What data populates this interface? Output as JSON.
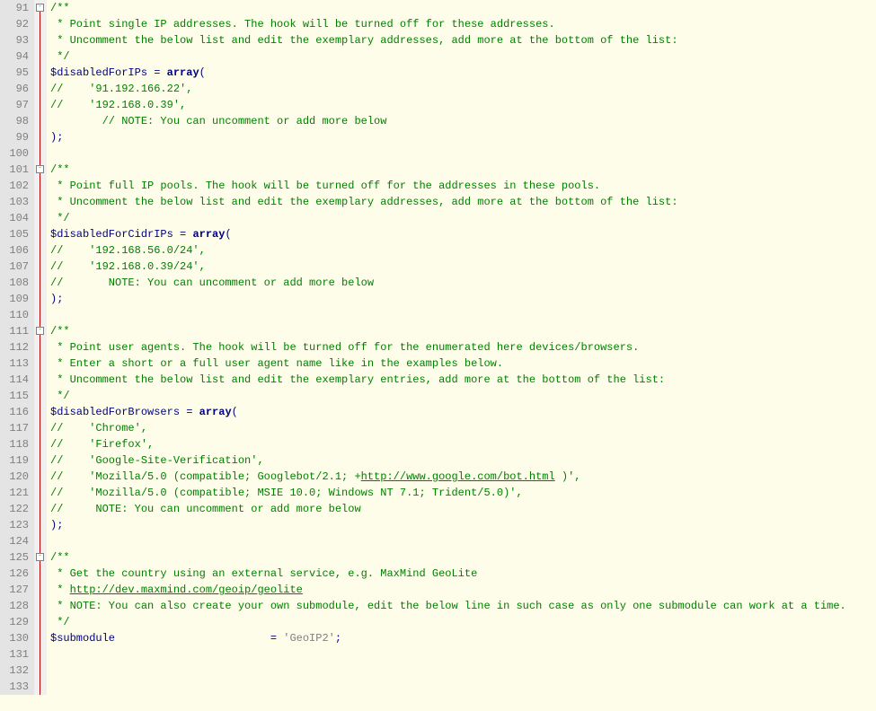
{
  "first_line": 91,
  "lines": [
    {
      "fold": "open",
      "tokens": [
        [
          "comment",
          "/**"
        ]
      ]
    },
    {
      "tokens": [
        [
          "comment",
          " * Point single IP addresses. The hook will be turned off for these addresses."
        ]
      ]
    },
    {
      "tokens": [
        [
          "comment",
          " * Uncomment the below list and edit the exemplary addresses, add more at the bottom of the list:"
        ]
      ]
    },
    {
      "tokens": [
        [
          "comment",
          " */"
        ]
      ]
    },
    {
      "tokens": [
        [
          "var",
          "$disabledForIPs"
        ],
        [
          "op",
          " "
        ],
        [
          "punct",
          "="
        ],
        [
          "op",
          " "
        ],
        [
          "keyword",
          "array"
        ],
        [
          "punct",
          "("
        ]
      ]
    },
    {
      "tokens": [
        [
          "comment",
          "//    '91.192.166.22',"
        ]
      ]
    },
    {
      "tokens": [
        [
          "comment",
          "//    '192.168.0.39',"
        ]
      ]
    },
    {
      "tokens": [
        [
          "comment",
          "        // NOTE: You can uncomment or add more below"
        ]
      ]
    },
    {
      "tokens": [
        [
          "punct",
          ");"
        ]
      ]
    },
    {
      "tokens": []
    },
    {
      "fold": "open",
      "tokens": [
        [
          "comment",
          "/**"
        ]
      ]
    },
    {
      "tokens": [
        [
          "comment",
          " * Point full IP pools. The hook will be turned off for the addresses in these pools."
        ]
      ]
    },
    {
      "tokens": [
        [
          "comment",
          " * Uncomment the below list and edit the exemplary addresses, add more at the bottom of the list:"
        ]
      ]
    },
    {
      "tokens": [
        [
          "comment",
          " */"
        ]
      ]
    },
    {
      "tokens": [
        [
          "var",
          "$disabledForCidrIPs"
        ],
        [
          "op",
          " "
        ],
        [
          "punct",
          "="
        ],
        [
          "op",
          " "
        ],
        [
          "keyword",
          "array"
        ],
        [
          "punct",
          "("
        ]
      ]
    },
    {
      "tokens": [
        [
          "comment",
          "//    '192.168.56.0/24',"
        ]
      ]
    },
    {
      "tokens": [
        [
          "comment",
          "//    '192.168.0.39/24',"
        ]
      ]
    },
    {
      "tokens": [
        [
          "comment",
          "//       NOTE: You can uncomment or add more below"
        ]
      ]
    },
    {
      "tokens": [
        [
          "punct",
          ");"
        ]
      ]
    },
    {
      "tokens": []
    },
    {
      "fold": "open",
      "tokens": [
        [
          "comment",
          "/**"
        ]
      ]
    },
    {
      "tokens": [
        [
          "comment",
          " * Point user agents. The hook will be turned off for the enumerated here devices/browsers."
        ]
      ]
    },
    {
      "tokens": [
        [
          "comment",
          " * Enter a short or a full user agent name like in the examples below."
        ]
      ]
    },
    {
      "tokens": [
        [
          "comment",
          " * Uncomment the below list and edit the exemplary entries, add more at the bottom of the list:"
        ]
      ]
    },
    {
      "tokens": [
        [
          "comment",
          " */"
        ]
      ]
    },
    {
      "tokens": [
        [
          "var",
          "$disabledForBrowsers"
        ],
        [
          "op",
          " "
        ],
        [
          "punct",
          "="
        ],
        [
          "op",
          " "
        ],
        [
          "keyword",
          "array"
        ],
        [
          "punct",
          "("
        ]
      ]
    },
    {
      "tokens": [
        [
          "comment",
          "//    'Chrome',"
        ]
      ]
    },
    {
      "tokens": [
        [
          "comment",
          "//    'Firefox',"
        ]
      ]
    },
    {
      "tokens": [
        [
          "comment",
          "//    'Google-Site-Verification',"
        ]
      ]
    },
    {
      "tokens": [
        [
          "comment",
          "//    'Mozilla/5.0 (compatible; Googlebot/2.1; +"
        ],
        [
          "url",
          "http://www.google.com/bot.html"
        ],
        [
          "comment",
          " )',"
        ]
      ]
    },
    {
      "tokens": [
        [
          "comment",
          "//    'Mozilla/5.0 (compatible; MSIE 10.0; Windows NT 7.1; Trident/5.0)',"
        ]
      ]
    },
    {
      "tokens": [
        [
          "comment",
          "//     NOTE: You can uncomment or add more below"
        ]
      ]
    },
    {
      "tokens": [
        [
          "punct",
          ");"
        ]
      ]
    },
    {
      "tokens": []
    },
    {
      "fold": "open",
      "tokens": [
        [
          "comment",
          "/**"
        ]
      ]
    },
    {
      "tokens": [
        [
          "comment",
          " * Get the country using an external service, e.g. MaxMind GeoLite"
        ]
      ]
    },
    {
      "tokens": [
        [
          "comment",
          " * "
        ],
        [
          "url",
          "http://dev.maxmind.com/geoip/geolite"
        ]
      ]
    },
    {
      "tokens": [
        [
          "comment",
          " * NOTE: You can also create your own submodule, edit the below line in such case as only one submodule can work at a time."
        ]
      ]
    },
    {
      "tokens": [
        [
          "comment",
          " */"
        ]
      ]
    },
    {
      "tokens": [
        [
          "var",
          "$submodule"
        ],
        [
          "op",
          "                        "
        ],
        [
          "punct",
          "="
        ],
        [
          "op",
          " "
        ],
        [
          "string",
          "'GeoIP2'"
        ],
        [
          "punct",
          ";"
        ]
      ]
    },
    {
      "tokens": []
    },
    {
      "tokens": []
    },
    {
      "tokens": []
    }
  ]
}
